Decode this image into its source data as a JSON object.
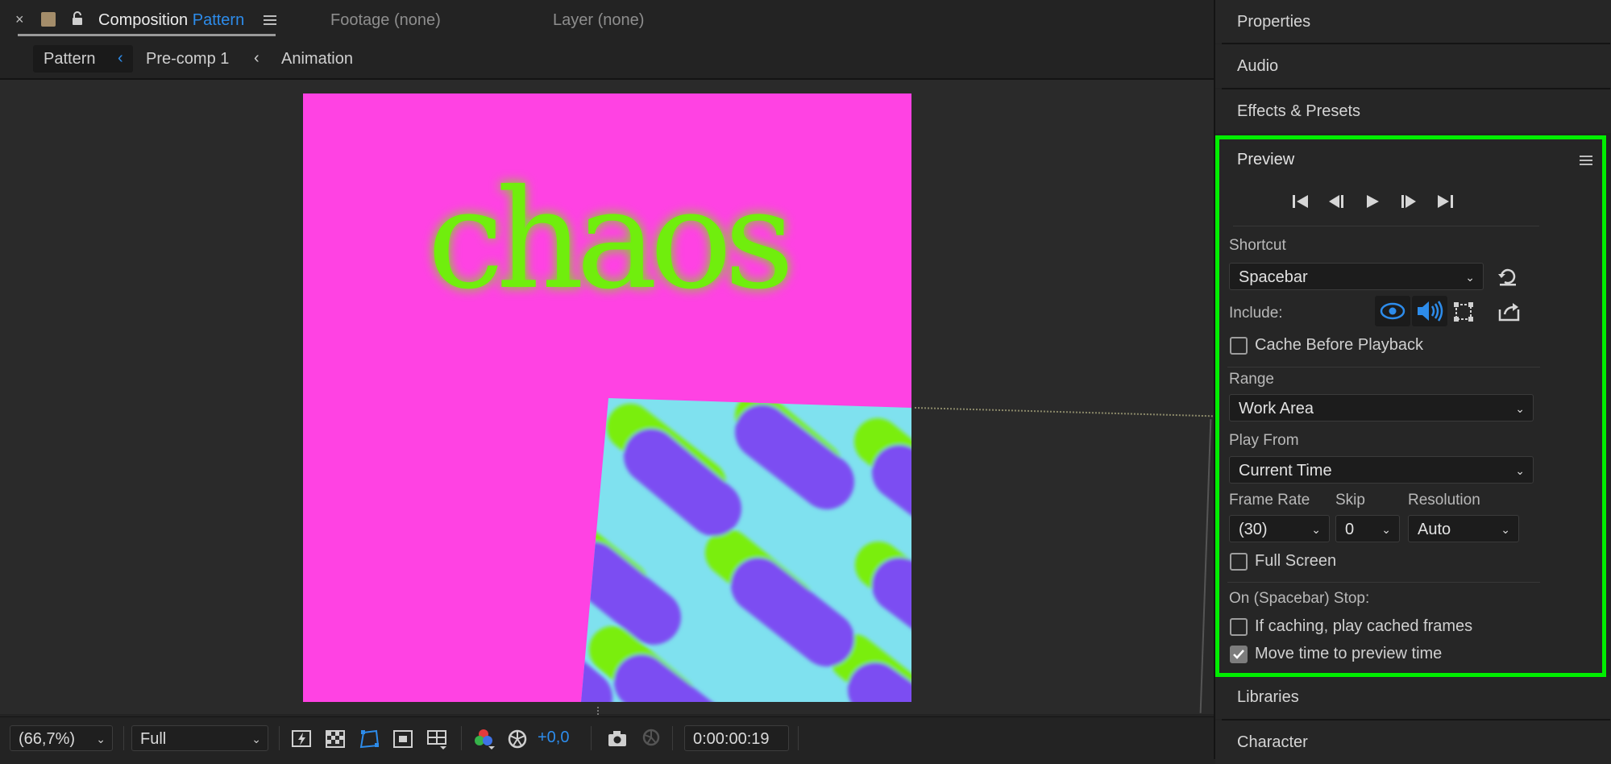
{
  "comp_panel": {
    "close_glyph": "×",
    "title_prefix": "Composition",
    "title_name": "Pattern",
    "footage_tab": "Footage (none)",
    "layer_tab": "Layer (none)",
    "flowchart": [
      "Pattern",
      "Pre-comp 1",
      "Animation"
    ],
    "canvas_text": "chaos",
    "canvas_colors": {
      "background": "#ff42e3",
      "text": "#6fee10",
      "pattern_bg": "#7fe1ef",
      "pill": "#7b4ef2",
      "pill_shadow": "#7aee10"
    }
  },
  "viewer_bar": {
    "zoom": "(66,7%)",
    "resolution": "Full",
    "exposure": "+0,0",
    "timecode": "0:00:00:19"
  },
  "side_panels": {
    "properties": "Properties",
    "audio": "Audio",
    "effects": "Effects & Presets",
    "libraries": "Libraries",
    "character": "Character"
  },
  "preview": {
    "title": "Preview",
    "shortcut_label": "Shortcut",
    "shortcut_value": "Spacebar",
    "include_label": "Include:",
    "cache_before": "Cache Before Playback",
    "range_label": "Range",
    "range_value": "Work Area",
    "play_from_label": "Play From",
    "play_from_value": "Current Time",
    "frame_rate_label": "Frame Rate",
    "frame_rate_value": "(30)",
    "skip_label": "Skip",
    "skip_value": "0",
    "resolution_label": "Resolution",
    "resolution_value": "Auto",
    "full_screen": "Full Screen",
    "on_stop_label": "On (Spacebar) Stop:",
    "if_caching": "If caching, play cached frames",
    "move_time": "Move time to preview time",
    "checkbox_states": {
      "cache_before": false,
      "full_screen": false,
      "if_caching": false,
      "move_time": true
    },
    "highlight_color": "#00ee00"
  }
}
